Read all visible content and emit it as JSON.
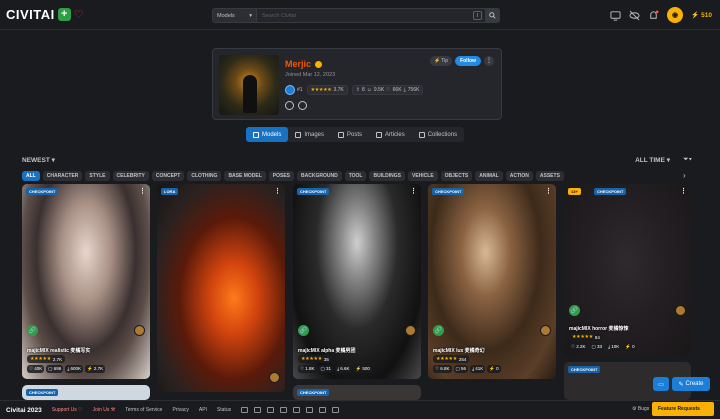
{
  "topbar": {
    "logo_text": "CIVITAI",
    "search_select": "Models",
    "search_placeholder": "Search Civitai",
    "slash_hint": "/",
    "buzz_amount": "510"
  },
  "profile": {
    "username": "Merjic",
    "joined": "Joined Mar 12, 2023",
    "rank": "#1",
    "rating_stars": "★★★★★",
    "rating_count": "3.7K",
    "stat_uploads": "8",
    "stat_downloads": "9.5K",
    "stat_likes": "66K",
    "stat_views": "756K",
    "tip_label": "Tip",
    "follow_label": "Follow"
  },
  "tabs": [
    {
      "label": "Models",
      "active": true
    },
    {
      "label": "Images"
    },
    {
      "label": "Posts"
    },
    {
      "label": "Articles"
    },
    {
      "label": "Collections"
    }
  ],
  "sort": {
    "label": "NEWEST",
    "period": "ALL TIME"
  },
  "categories": [
    "ALL",
    "CHARACTER",
    "STYLE",
    "CELEBRITY",
    "CONCEPT",
    "CLOTHING",
    "BASE MODEL",
    "POSES",
    "BACKGROUND",
    "TOOL",
    "BUILDINGS",
    "VEHICLE",
    "OBJECTS",
    "ANIMAL",
    "ACTION",
    "ASSETS"
  ],
  "cards": [
    {
      "tag": "CHECKPOINT",
      "title": "majicMIX realistic 麦橘写实",
      "stars": "★★★★★",
      "rating": "2.7K",
      "stats": [
        "♡ 40K",
        "▢ 696",
        "⤓ 600K",
        "⚡ 2.7K"
      ]
    },
    {
      "tag": "LORA",
      "title": "",
      "stars": "",
      "rating": "",
      "stats": []
    },
    {
      "tag": "CHECKPOINT",
      "title": "majicMIX alpha 麦橘男团",
      "stars": "★★★★★",
      "rating": "35",
      "stats": [
        "♡ 1.8K",
        "▢ 31",
        "⤓ 6.6K",
        "⚡ 500"
      ]
    },
    {
      "tag": "CHECKPOINT",
      "title": "majicMIX lux 麦橘奇幻",
      "stars": "★★★★★",
      "rating": "254",
      "stats": [
        "♡ 6.8K",
        "▢ 56",
        "⤓ 41K",
        "⚡ 0"
      ]
    },
    {
      "tag": "CHECKPOINT",
      "prefix_tag": "13+",
      "title": "majicMIX horror 麦橘惊悚",
      "stars": "★★★★★",
      "rating": "84",
      "stats": [
        "♡ 2.2K",
        "▢ 33",
        "⤓ 10K",
        "⚡ 0"
      ]
    }
  ],
  "bottom_cards": [
    {
      "tag": "CHECKPOINT"
    },
    {
      "tag": "CHECKPOINT"
    },
    {
      "tag": "CHECKPOINT"
    }
  ],
  "footer": {
    "copyright": "Civitai 2023",
    "links": [
      "Support Us ♡",
      "Join Us ⚒",
      "Terms of Service",
      "Privacy",
      "API",
      "Status"
    ],
    "bugs": "Bugs",
    "feature": "Feature Requests"
  },
  "actions": {
    "create_label": "Create"
  },
  "colors": {
    "accent": "#1971c2",
    "brand_green": "#2f9e44",
    "username": "#e8590c",
    "star": "#fab005"
  }
}
